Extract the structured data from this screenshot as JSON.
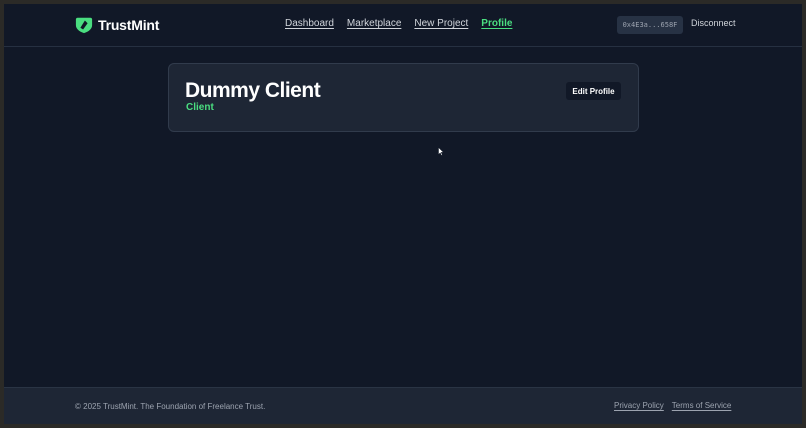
{
  "header": {
    "brand": "TrustMint",
    "nav": [
      {
        "label": "Dashboard"
      },
      {
        "label": "Marketplace"
      },
      {
        "label": "New Project"
      },
      {
        "label": "Profile",
        "active": true
      }
    ],
    "wallet_address": "0x4E3a...658F",
    "disconnect_label": "Disconnect"
  },
  "profile": {
    "name": "Dummy Client",
    "role": "Client",
    "edit_label": "Edit Profile"
  },
  "footer": {
    "copyright": "© 2025 TrustMint. The Foundation of Freelance Trust.",
    "links": [
      {
        "label": "Privacy Policy"
      },
      {
        "label": "Terms of Service"
      }
    ]
  },
  "icons": {
    "brand": "trustmint-logo-icon",
    "cursor": "mouse-pointer-icon"
  },
  "colors": {
    "background": "#111827",
    "card": "#1e2635",
    "accent": "#4ade80",
    "text": "#ffffff",
    "muted": "#9ca3af"
  }
}
